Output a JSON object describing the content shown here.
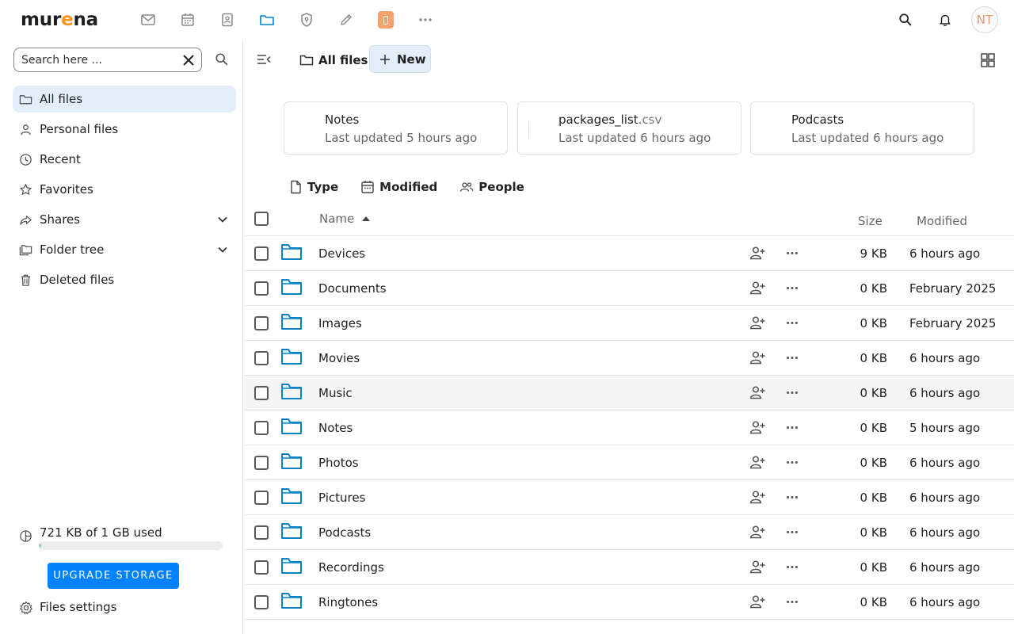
{
  "header": {
    "logo_prefix": "mur",
    "logo_accent": "e",
    "logo_suffix": "na",
    "avatar_initials": "NT",
    "apps": [
      "mail-icon",
      "calendar-icon",
      "contacts-icon",
      "files-icon",
      "passwords-icon",
      "notes-icon",
      "phone-app-icon",
      "more-apps-icon"
    ]
  },
  "sidebar": {
    "search_placeholder": "Search here ...",
    "items": [
      {
        "label": "All files",
        "icon": "folder-icon",
        "active": true
      },
      {
        "label": "Personal files",
        "icon": "person-icon"
      },
      {
        "label": "Recent",
        "icon": "clock-icon"
      },
      {
        "label": "Favorites",
        "icon": "star-icon"
      },
      {
        "label": "Shares",
        "icon": "share-icon",
        "expandable": true
      },
      {
        "label": "Folder tree",
        "icon": "folder-tree-icon",
        "expandable": true
      },
      {
        "label": "Deleted files",
        "icon": "trash-icon"
      }
    ],
    "quota_text": "721 KB of 1 GB used",
    "quota_fraction": 0.0007,
    "upgrade_label": "UPGRADE STORAGE",
    "settings_label": "Files settings"
  },
  "main": {
    "breadcrumb": "All files",
    "new_label": "New",
    "recent_cards": [
      {
        "name": "Notes",
        "ext": "",
        "time": "Last updated 5 hours ago"
      },
      {
        "name": "packages_list",
        "ext": ".csv",
        "time": "Last updated 6 hours ago"
      },
      {
        "name": "Podcasts",
        "ext": "",
        "time": "Last updated 6 hours ago"
      }
    ],
    "filters": [
      {
        "label": "Type",
        "icon": "file-type-icon"
      },
      {
        "label": "Modified",
        "icon": "calendar-icon"
      },
      {
        "label": "People",
        "icon": "people-icon"
      }
    ],
    "columns": {
      "name": "Name",
      "size": "Size",
      "modified": "Modified"
    },
    "rows": [
      {
        "name": "Devices",
        "size": "9 KB",
        "modified": "6 hours ago"
      },
      {
        "name": "Documents",
        "size": "0 KB",
        "modified": "February 2025"
      },
      {
        "name": "Images",
        "size": "0 KB",
        "modified": "February 2025"
      },
      {
        "name": "Movies",
        "size": "0 KB",
        "modified": "6 hours ago"
      },
      {
        "name": "Music",
        "size": "0 KB",
        "modified": "6 hours ago",
        "hover": true
      },
      {
        "name": "Notes",
        "size": "0 KB",
        "modified": "5 hours ago"
      },
      {
        "name": "Photos",
        "size": "0 KB",
        "modified": "6 hours ago"
      },
      {
        "name": "Pictures",
        "size": "0 KB",
        "modified": "6 hours ago"
      },
      {
        "name": "Podcasts",
        "size": "0 KB",
        "modified": "6 hours ago"
      },
      {
        "name": "Recordings",
        "size": "0 KB",
        "modified": "6 hours ago"
      },
      {
        "name": "Ringtones",
        "size": "0 KB",
        "modified": "6 hours ago"
      }
    ]
  },
  "colors": {
    "accent": "#0082c9",
    "upgrade": "#0082fd",
    "active_bg": "#e4eefb",
    "folder": "#0082c9",
    "logo_accent": "#f7941d"
  }
}
